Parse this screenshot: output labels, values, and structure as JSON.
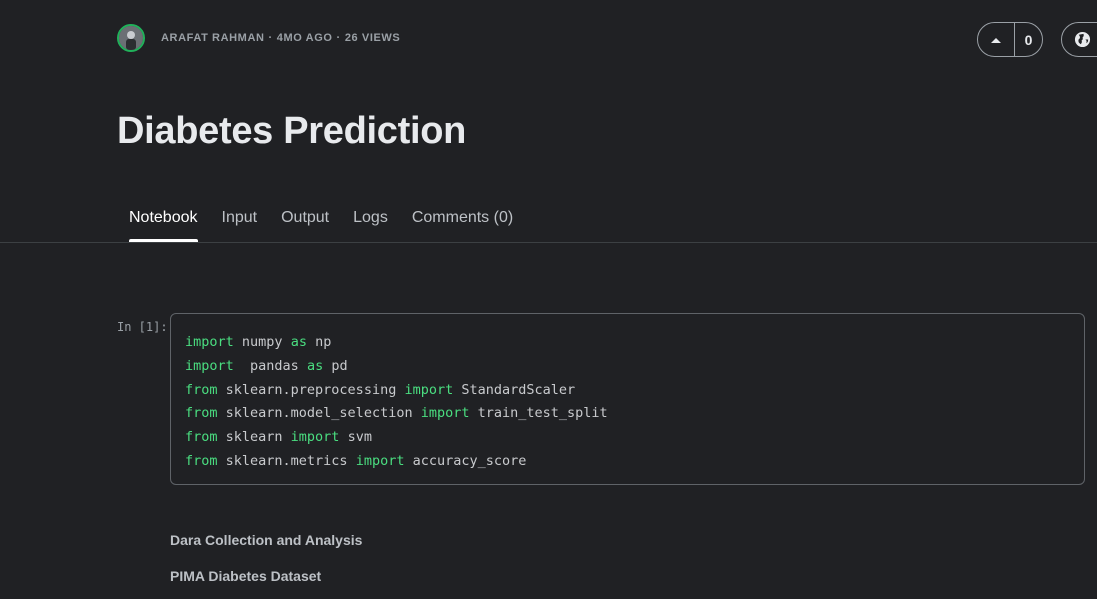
{
  "header": {
    "author": "ARAFAT RAHMAN",
    "age": "4MO AGO",
    "views": "26 VIEWS",
    "separator": "·",
    "vote_count": "0"
  },
  "title": "Diabetes Prediction",
  "tabs": [
    {
      "label": "Notebook",
      "active": true
    },
    {
      "label": "Input",
      "active": false
    },
    {
      "label": "Output",
      "active": false
    },
    {
      "label": "Logs",
      "active": false
    },
    {
      "label": "Comments (0)",
      "active": false
    }
  ],
  "cell": {
    "prompt": "In [1]:",
    "lines": [
      [
        {
          "t": "import",
          "k": true
        },
        {
          "t": " numpy ",
          "k": false
        },
        {
          "t": "as",
          "k": true
        },
        {
          "t": " np",
          "k": false
        }
      ],
      [
        {
          "t": "import",
          "k": true
        },
        {
          "t": "  pandas ",
          "k": false
        },
        {
          "t": "as",
          "k": true
        },
        {
          "t": " pd",
          "k": false
        }
      ],
      [
        {
          "t": "from",
          "k": true
        },
        {
          "t": " sklearn.preprocessing ",
          "k": false
        },
        {
          "t": "import",
          "k": true
        },
        {
          "t": " StandardScaler",
          "k": false
        }
      ],
      [
        {
          "t": "from",
          "k": true
        },
        {
          "t": " sklearn.model_selection ",
          "k": false
        },
        {
          "t": "import",
          "k": true
        },
        {
          "t": " train_test_split",
          "k": false
        }
      ],
      [
        {
          "t": "from",
          "k": true
        },
        {
          "t": " sklearn ",
          "k": false
        },
        {
          "t": "import",
          "k": true
        },
        {
          "t": " svm",
          "k": false
        }
      ],
      [
        {
          "t": "from",
          "k": true
        },
        {
          "t": " sklearn.metrics ",
          "k": false
        },
        {
          "t": "import",
          "k": true
        },
        {
          "t": " accuracy_score",
          "k": false
        }
      ]
    ]
  },
  "markdown": {
    "heading1": "Dara Collection and Analysis",
    "heading2": "PIMA Diabetes Dataset"
  },
  "colors": {
    "background": "#202124",
    "keyword": "#4ade80",
    "avatar_ring": "#20b15a"
  },
  "icons": {
    "upvote": "chevron-up-icon",
    "globe": "globe-icon"
  }
}
